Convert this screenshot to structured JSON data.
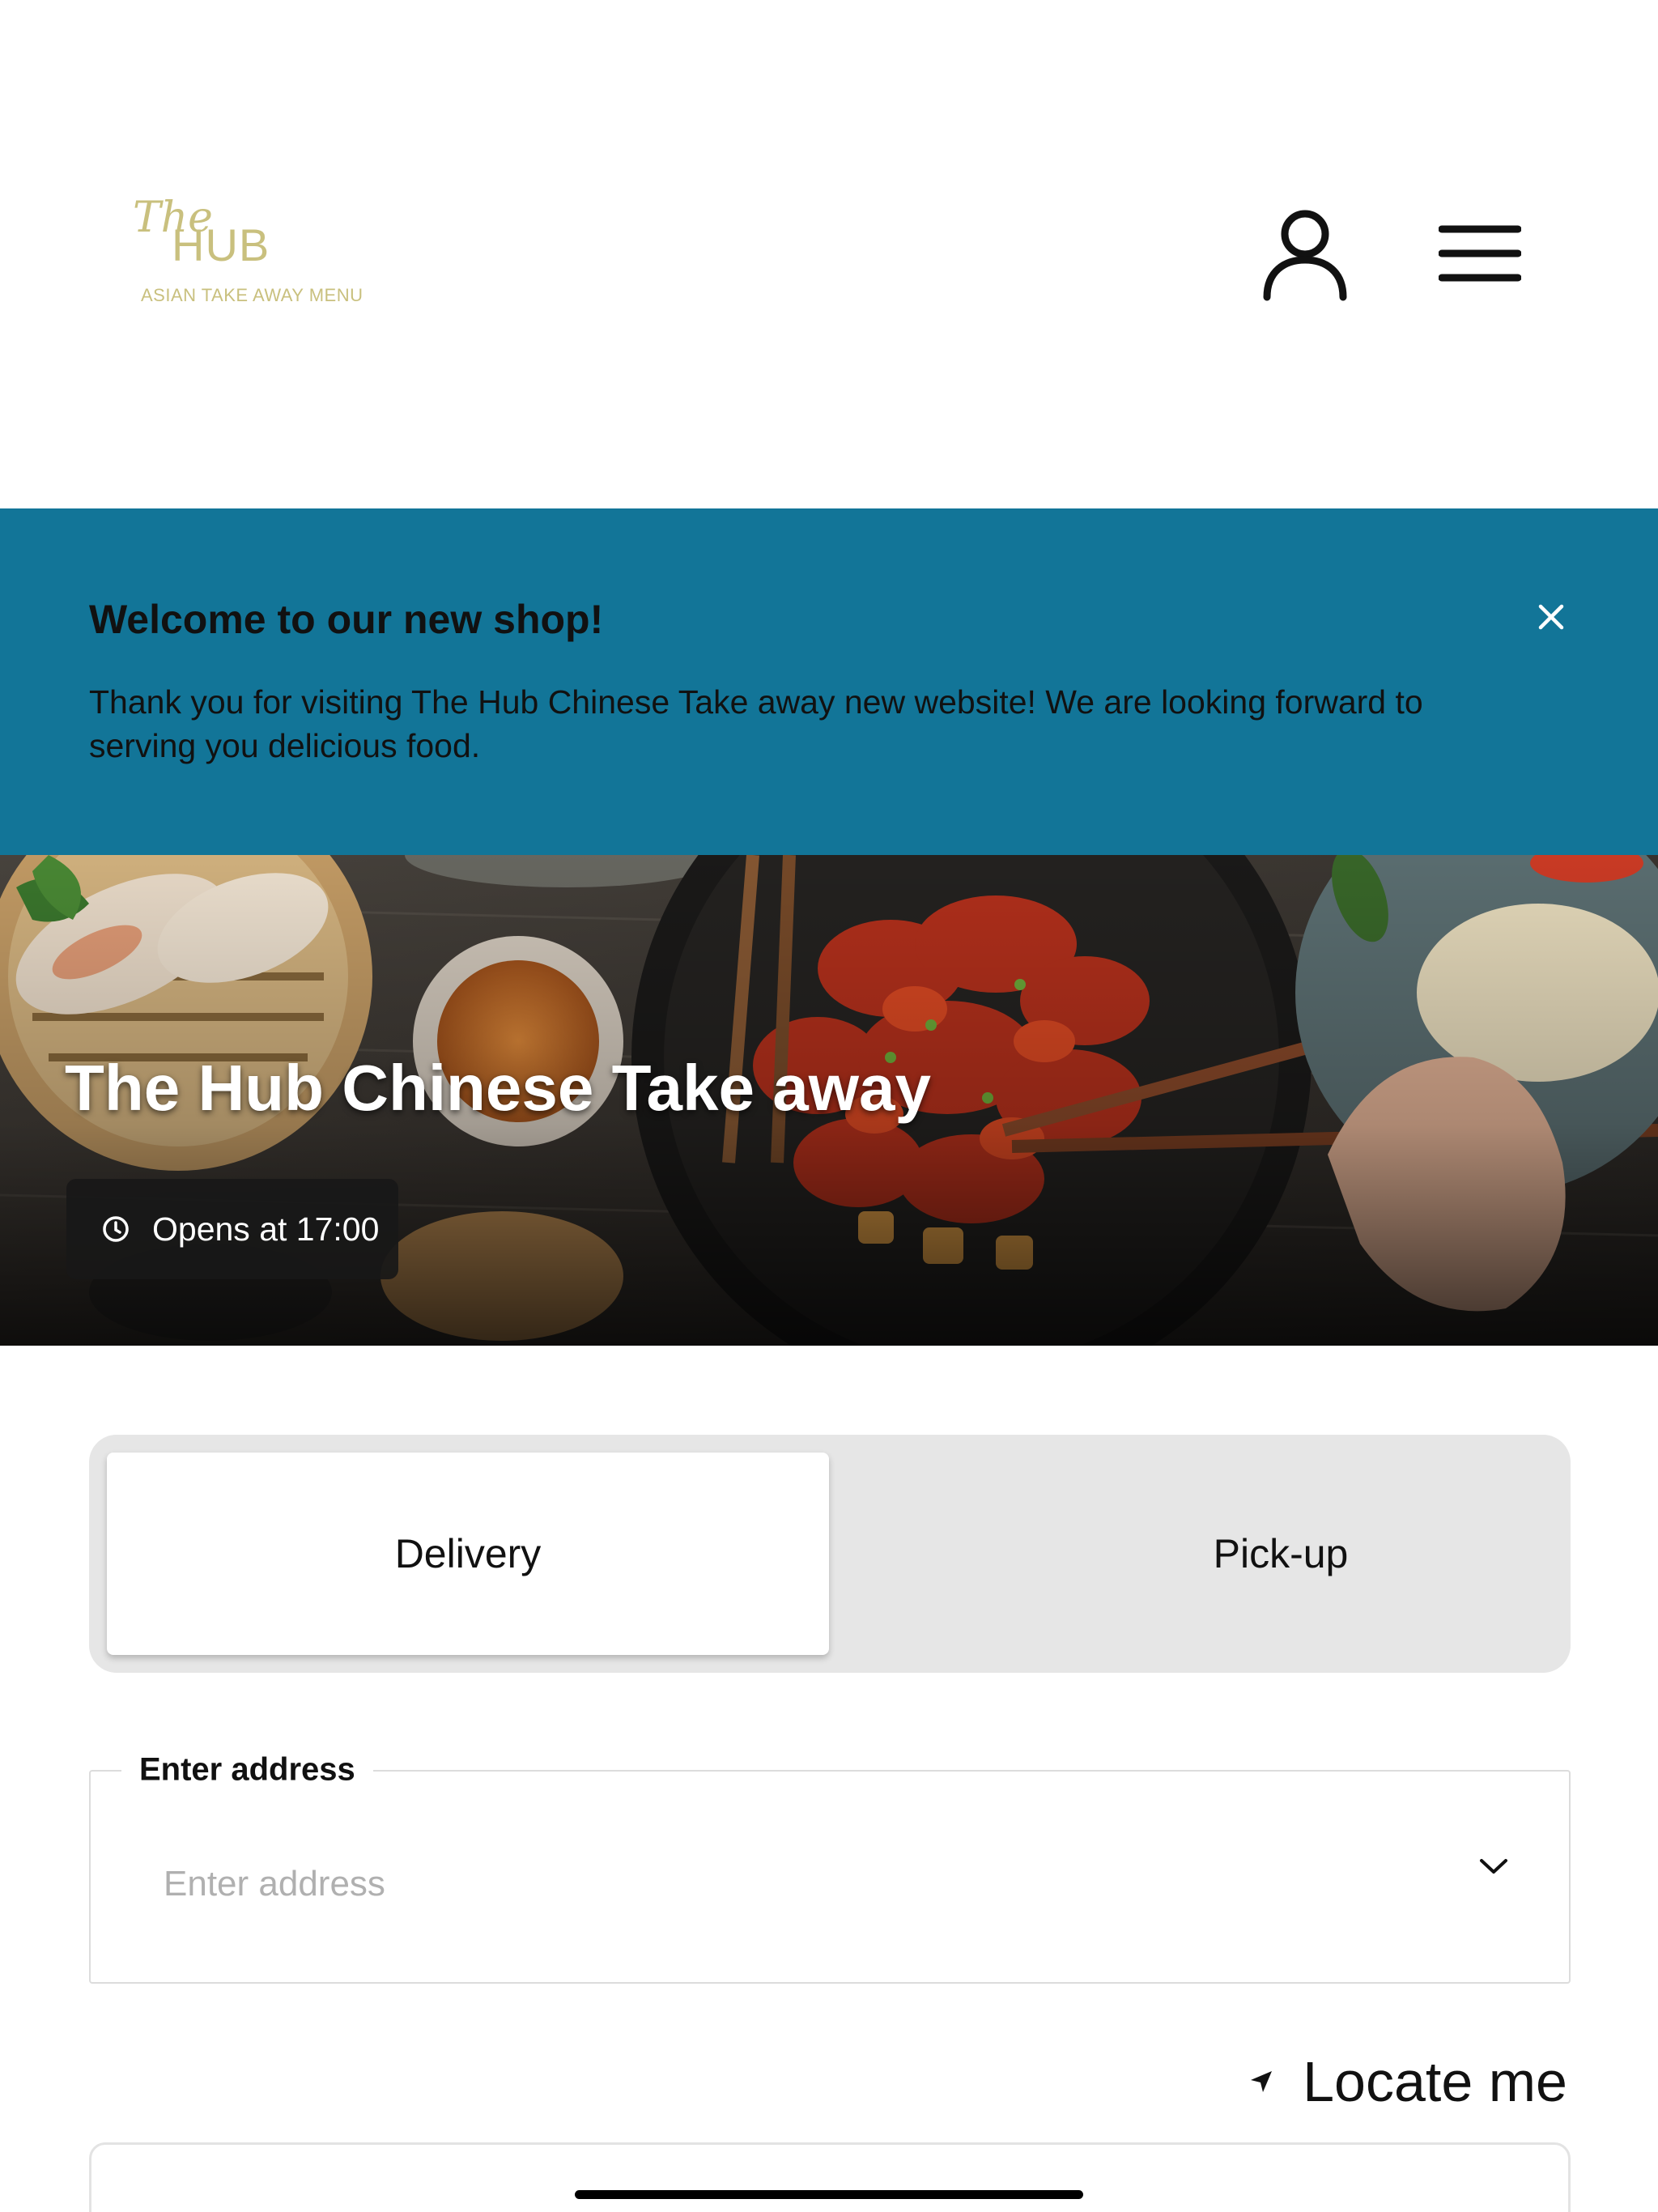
{
  "header": {
    "logo": {
      "script_text": "The",
      "brand_text": "HUB",
      "tagline": "ASIAN TAKE AWAY MENU",
      "color": "#c9c07e"
    },
    "account_icon": "user-icon",
    "menu_icon": "hamburger-menu-icon"
  },
  "banner": {
    "title": "Welcome to our new shop!",
    "text": "Thank you for visiting The Hub Chinese Take away new website! We are looking forward to serving you delicious food.",
    "background_color": "#127598",
    "close_icon": "close-icon"
  },
  "hero": {
    "title": "The Hub Chinese Take away",
    "hours_text": "Opens at 17:00",
    "hours_icon": "clock-icon"
  },
  "order_type": {
    "options": [
      {
        "label": "Delivery",
        "selected": true
      },
      {
        "label": "Pick-up",
        "selected": false
      }
    ]
  },
  "address": {
    "label": "Enter address",
    "placeholder": "Enter address",
    "value": "",
    "chevron_icon": "chevron-down-icon"
  },
  "locate": {
    "label": "Locate me",
    "icon": "location-arrow-icon"
  }
}
